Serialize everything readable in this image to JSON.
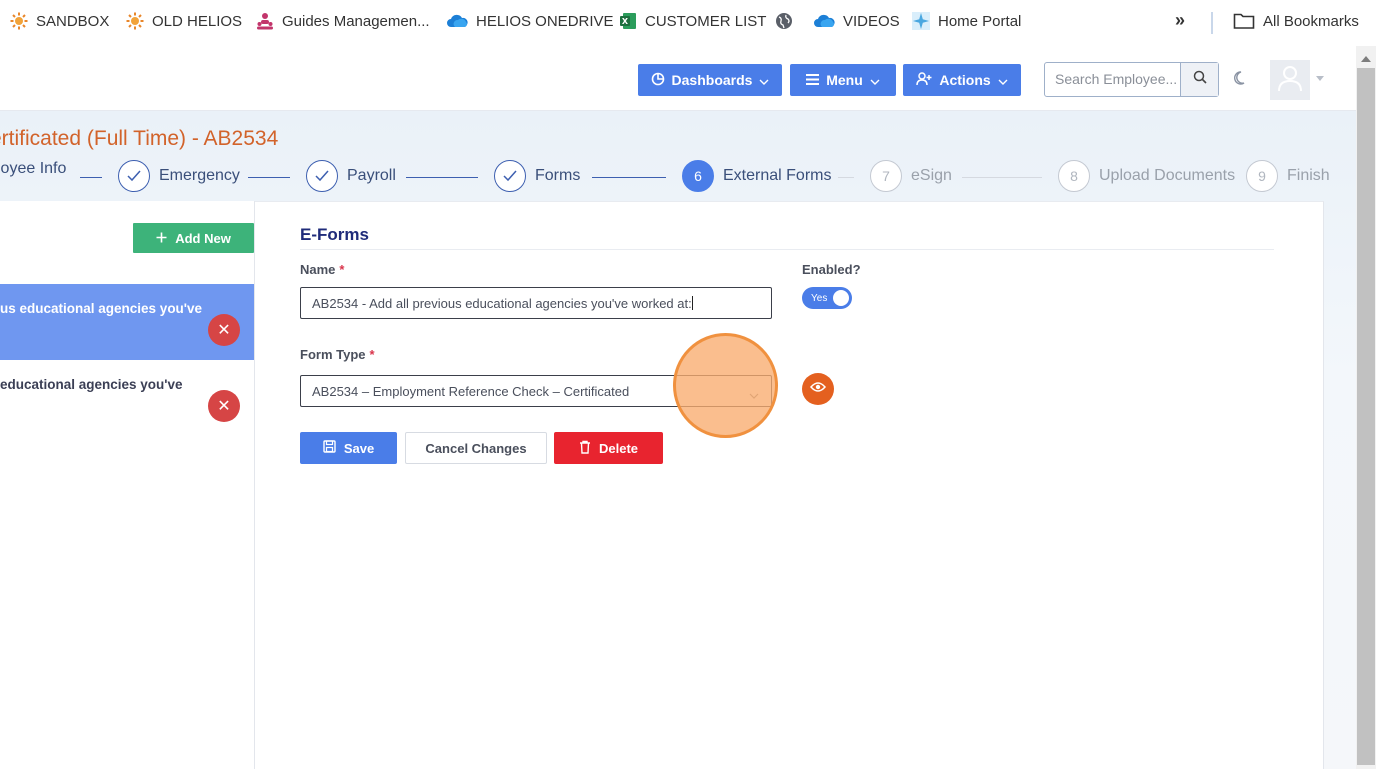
{
  "bookmarks": [
    {
      "label": "SANDBOX",
      "icon": "sun-logo-icon"
    },
    {
      "label": "OLD HELIOS",
      "icon": "sun-logo-icon"
    },
    {
      "label": "Guides Managemen...",
      "icon": "people-icon"
    },
    {
      "label": "HELIOS ONEDRIVE",
      "icon": "onedrive-cloud-icon"
    },
    {
      "label": "CUSTOMER LIST",
      "icon": "excel-icon"
    },
    {
      "label": "",
      "icon": "globe-icon"
    },
    {
      "label": "VIDEOS",
      "icon": "onedrive-cloud-icon"
    },
    {
      "label": "Home Portal",
      "icon": "sparkle-icon"
    }
  ],
  "bookmarks_overflow": "»",
  "all_bookmarks": "All Bookmarks",
  "header": {
    "dashboards": "Dashboards",
    "menu": "Menu",
    "actions": "Actions",
    "search_placeholder": "Search Employee..."
  },
  "page_title": "ertificated (Full Time) - AB2534",
  "steps": [
    {
      "label": "loyee Info",
      "state": "done"
    },
    {
      "label": "Emergency",
      "state": "done"
    },
    {
      "label": "Payroll",
      "state": "done"
    },
    {
      "label": "Forms",
      "state": "done"
    },
    {
      "num": "6",
      "label": "External Forms",
      "state": "active"
    },
    {
      "num": "7",
      "label": "eSign",
      "state": "todo"
    },
    {
      "num": "8",
      "label": "Upload Documents",
      "state": "todo"
    },
    {
      "num": "9",
      "label": "Finish",
      "state": "todo"
    }
  ],
  "left": {
    "add_new": "Add New",
    "items": [
      "us educational agencies you've",
      " educational agencies you've"
    ],
    "remove_glyph": "✕"
  },
  "form": {
    "section_title": "E-Forms",
    "name_label": "Name",
    "required_mark": "*",
    "name_value": "AB2534 - Add all previous educational agencies you've worked at:",
    "enabled_label": "Enabled?",
    "enabled_toggle": "Yes",
    "form_type_label": "Form Type",
    "form_type_value": "AB2534 – Employment Reference Check – Certificated",
    "save": "Save",
    "cancel": "Cancel Changes",
    "delete": "Delete"
  },
  "colors": {
    "primary": "#4a7de8",
    "success": "#3db37a",
    "danger": "#e8242f",
    "accent_orange": "#e4601f",
    "title_orange": "#d2632a",
    "navy": "#1f2b7a"
  }
}
